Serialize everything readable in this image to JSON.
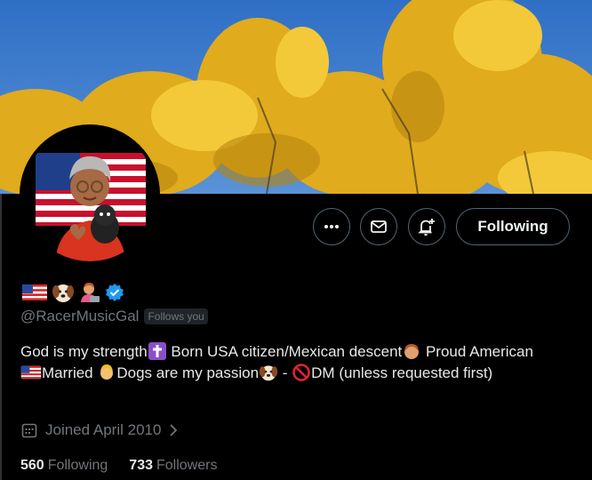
{
  "profile": {
    "handle": "@RacerMusicGal",
    "follows_you_badge": "Follows you",
    "verified": true,
    "name_emojis": [
      "us-flag",
      "dog-face",
      "woman-technologist"
    ],
    "bio_parts": {
      "p1": "God is my strength",
      "p2": " Born USA citizen/Mexican descent",
      "p3": " Proud American",
      "p4": "Married ",
      "p5": "Dogs are my passion",
      "p6": " - ",
      "p7": "DM (unless requested first)"
    },
    "joined": "Joined April 2010",
    "following_count": "560",
    "following_label": "Following",
    "followers_count": "733",
    "followers_label": "Followers"
  },
  "actions": {
    "more_icon": "more-horizontal-icon",
    "message_icon": "envelope-icon",
    "notify_icon": "bell-plus-icon",
    "following_button": "Following"
  },
  "colors": {
    "background": "#000000",
    "text": "#e7e9ea",
    "muted": "#71767b",
    "verified": "#1d9bf0",
    "banner_sky": "#3a78c8",
    "banner_foliage": "#e8b624"
  }
}
